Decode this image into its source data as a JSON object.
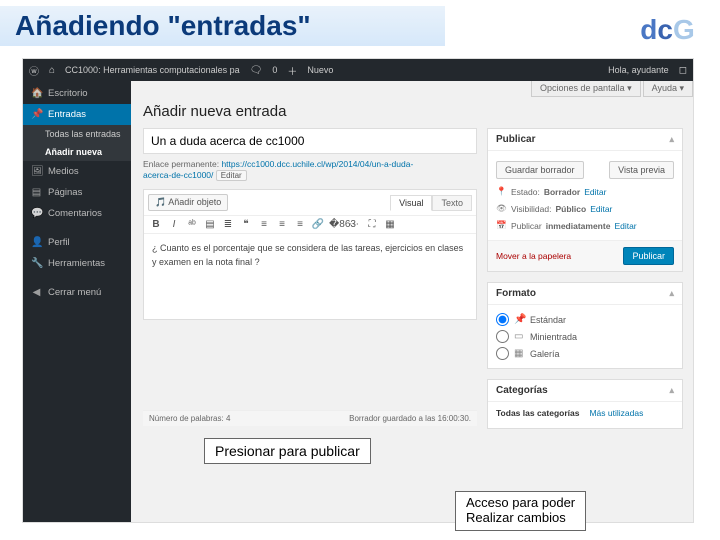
{
  "slide": {
    "title": "Añadiendo \"entradas\""
  },
  "adminbar": {
    "site": "CC1000: Herramientas computacionales pa",
    "comments": "0",
    "new": "Nuevo",
    "greeting": "Hola, ayudante"
  },
  "sidebar": {
    "dashboard": "Escritorio",
    "posts": "Entradas",
    "all": "Todas las entradas",
    "addnew": "Añadir nueva",
    "media": "Medios",
    "pages": "Páginas",
    "comments": "Comentarios",
    "profile": "Perfil",
    "tools": "Herramientas",
    "collapse": "Cerrar menú"
  },
  "main": {
    "screenopts": "Opciones de pantalla",
    "help": "Ayuda",
    "heading": "Añadir nueva entrada",
    "titleval": "Un a duda acerca de cc1000",
    "permalink_label": "Enlace permanente:",
    "permalink_url": "https://cc1000.dcc.uchile.cl/wp/2014/04/un-a-duda-",
    "permalink_slug": "acerca-de-cc1000/",
    "permalink_edit": "Editar",
    "addmedia": "Añadir objeto",
    "tab_visual": "Visual",
    "tab_text": "Texto",
    "content": "¿ Cuanto es el porcentaje que se considera de las tareas, ejercicios en clases y examen en la nota final ?",
    "wordcount_label": "Número de palabras:",
    "wordcount": "4",
    "draftsaved": "Borrador guardado a las 16:00:30."
  },
  "publish": {
    "title": "Publicar",
    "savedraft": "Guardar borrador",
    "preview": "Vista previa",
    "status_label": "Estado:",
    "status_val": "Borrador",
    "status_edit": "Editar",
    "visibility_label": "Visibilidad:",
    "visibility_val": "Público",
    "visibility_edit": "Editar",
    "schedule_label": "Publicar",
    "schedule_val": "inmediatamente",
    "schedule_edit": "Editar",
    "trash": "Mover a la papelera",
    "publishbtn": "Publicar"
  },
  "format": {
    "title": "Formato",
    "standard": "Estándar",
    "aside": "Minientrada",
    "gallery": "Galería"
  },
  "categories": {
    "title": "Categorías",
    "all": "Todas las categorías",
    "mostused": "Más utilizadas"
  },
  "callouts": {
    "c1": "Presionar para publicar",
    "c2a": "Acceso para poder",
    "c2b": "Realizar cambios"
  }
}
